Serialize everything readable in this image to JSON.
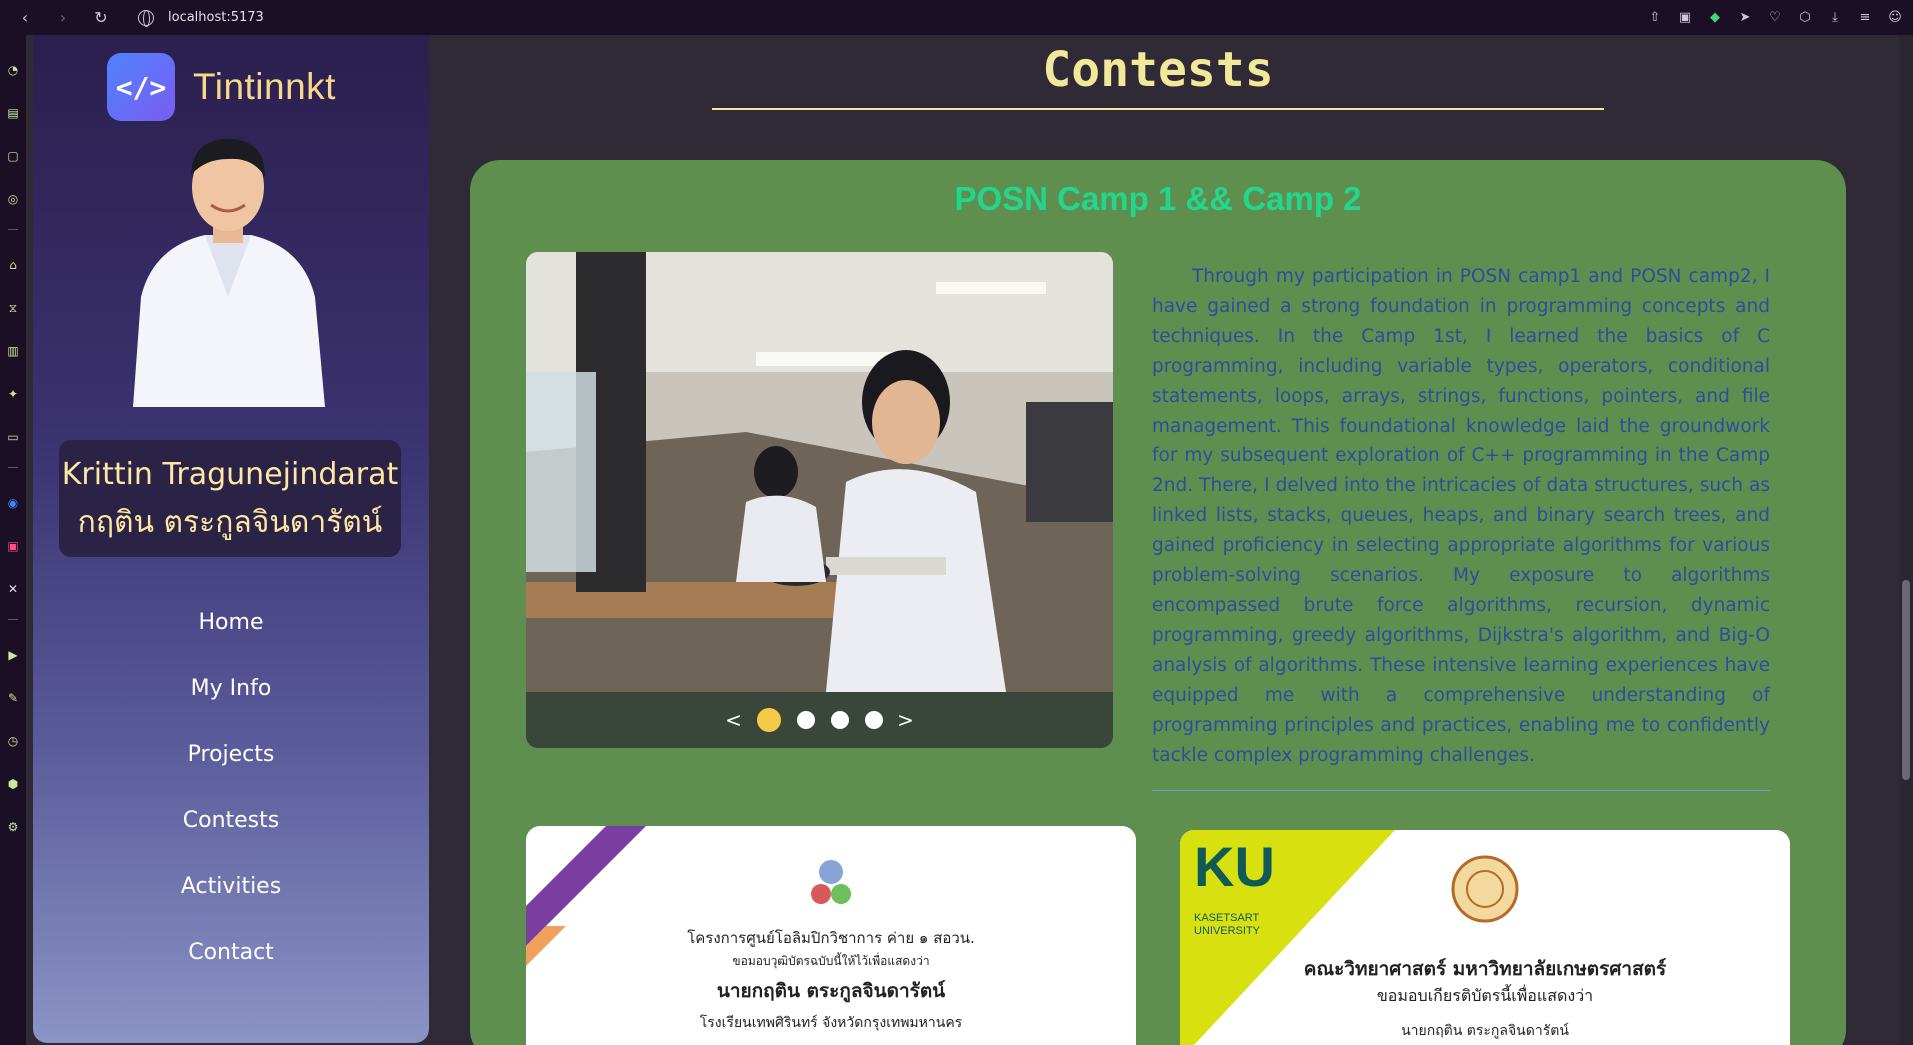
{
  "browser": {
    "url": "localhost:5173"
  },
  "sidebar": {
    "brand_name": "Tintinnkt",
    "brand_logo_glyph": "</>",
    "name_en": "Krittin Tragunejindarat",
    "name_th": "กฤติน ตระกูลจินดารัตน์",
    "menu": [
      {
        "label": "Home"
      },
      {
        "label": "My Info"
      },
      {
        "label": "Projects"
      },
      {
        "label": "Contests"
      },
      {
        "label": "Activities"
      },
      {
        "label": "Contact"
      }
    ]
  },
  "main": {
    "page_title": "Contests",
    "card": {
      "title": "POSN Camp 1 && Camp 2",
      "carousel": {
        "prev": "<",
        "next": ">",
        "slides": 4,
        "active_slide": 1
      },
      "description": "Through my participation in POSN camp1 and POSN camp2, I have gained a strong foundation in programming concepts and techniques. In the Camp 1st, I learned the basics of C programming, including variable types, operators, conditional statements, loops, arrays, strings, functions, pointers, and file management. This foundational knowledge laid the groundwork for my subsequent exploration of C++ programming in the Camp 2nd. There, I delved into the intricacies of data structures, such as linked lists, stacks, queues, heaps, and binary search trees, and gained proficiency in selecting appropriate algorithms for various problem-solving scenarios. My exposure to algorithms encompassed brute force algorithms, recursion, dynamic programming, greedy algorithms, Dijkstra's algorithm, and Big-O analysis of algorithms. These intensive learning experiences have equipped me with a comprehensive understanding of programming principles and practices, enabling me to confidently tackle complex programming challenges.",
      "certificates": [
        {
          "lines": [
            "โครงการศูนย์โอลิมปิกวิชาการ ค่าย ๑ สอวน.",
            "ขอมอบวุฒิบัตรฉบับนี้ให้ไว้เพื่อแสดงว่า",
            "นายกฤติน  ตระกูลจินดารัตน์",
            "โรงเรียนเทพศิรินทร์ จังหวัดกรุงเทพมหานคร"
          ]
        },
        {
          "logo_text": "KU",
          "logo_sub": "KASETSART UNIVERSITY",
          "lines": [
            "คณะวิทยาศาสตร์ มหาวิทยาลัยเกษตรศาสตร์",
            "ขอมอบเกียรติบัตรนี้เพื่อแสดงว่า",
            "นายกฤติน  ตระกูลจินดารัตน์"
          ]
        }
      ]
    }
  },
  "colors": {
    "accent_title": "#f2e89a",
    "card_bg": "#5f8f4e",
    "card_title": "#23d68e",
    "desc_text": "#2e4c9e",
    "dot_active": "#f7c948"
  }
}
